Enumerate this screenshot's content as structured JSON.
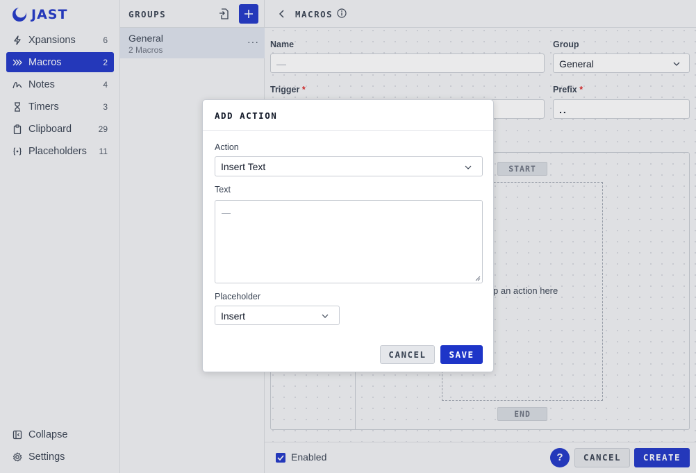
{
  "app": {
    "logo_text": "JAST",
    "brand_color": "#1e35c8"
  },
  "sidebar": {
    "items": [
      {
        "label": "Xpansions",
        "count": "6",
        "icon": "bolt-icon"
      },
      {
        "label": "Macros",
        "count": "2",
        "icon": "double-chevron-icon",
        "active": true
      },
      {
        "label": "Notes",
        "count": "4",
        "icon": "scribble-icon"
      },
      {
        "label": "Timers",
        "count": "3",
        "icon": "hourglass-icon"
      },
      {
        "label": "Clipboard",
        "count": "29",
        "icon": "clipboard-icon"
      },
      {
        "label": "Placeholders",
        "count": "11",
        "icon": "braces-icon"
      }
    ],
    "collapse_label": "Collapse",
    "settings_label": "Settings"
  },
  "groups": {
    "title": "GROUPS",
    "items": [
      {
        "name": "General",
        "subtitle": "2 Macros"
      }
    ],
    "more_glyph": "···"
  },
  "main": {
    "title": "MACROS",
    "form": {
      "name_label": "Name",
      "name_placeholder": "—",
      "group_label": "Group",
      "group_value": "General",
      "trigger_label": "Trigger",
      "required_mark": "*",
      "prefix_label": "Prefix",
      "prefix_value": ".."
    },
    "editor": {
      "start_label": "START",
      "end_label": "END",
      "drop_hint": "op an action here"
    },
    "footer": {
      "enabled_label": "Enabled",
      "enabled_checked": true,
      "help_label": "?",
      "cancel_label": "CANCEL",
      "create_label": "CREATE"
    }
  },
  "modal": {
    "title": "ADD ACTION",
    "action_label": "Action",
    "action_value": "Insert Text",
    "text_label": "Text",
    "text_placeholder": "—",
    "placeholder_label": "Placeholder",
    "placeholder_value": "Insert",
    "cancel_label": "CANCEL",
    "save_label": "SAVE"
  }
}
